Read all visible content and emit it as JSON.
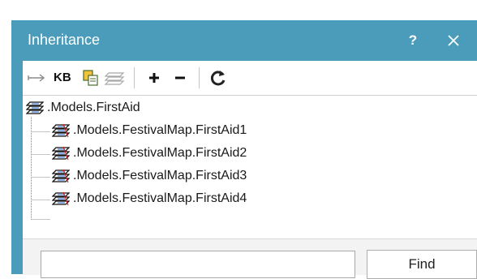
{
  "dialog": {
    "title": "Inheritance",
    "help_label": "?",
    "close_icon": "close-icon"
  },
  "toolbar": {
    "items": [
      {
        "name": "go-to-definition-icon"
      },
      {
        "name": "kb-button",
        "label": "KB"
      },
      {
        "name": "copy-icon"
      },
      {
        "name": "layers-icon"
      },
      {
        "name": "add-icon"
      },
      {
        "name": "remove-icon"
      },
      {
        "name": "refresh-icon"
      }
    ],
    "kb_label": "KB"
  },
  "tree": {
    "root": {
      "label": ".Models.FirstAid",
      "icon": "model-stack-icon"
    },
    "children": [
      {
        "label": ".Models.FestivalMap.FirstAid1",
        "icon": "model-stack-icon"
      },
      {
        "label": ".Models.FestivalMap.FirstAid2",
        "icon": "model-stack-icon"
      },
      {
        "label": ".Models.FestivalMap.FirstAid3",
        "icon": "model-stack-icon"
      },
      {
        "label": ".Models.FestivalMap.FirstAid4",
        "icon": "model-stack-icon"
      }
    ]
  },
  "search": {
    "value": "",
    "placeholder": "",
    "find_label": "Find"
  },
  "colors": {
    "titlebar": "#4a9cba",
    "background": "#ffffff",
    "footer": "#f3f3f3"
  }
}
